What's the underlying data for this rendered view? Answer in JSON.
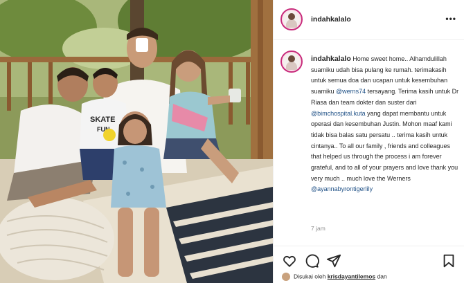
{
  "post": {
    "username": "indahkalalo",
    "more_label": "•••",
    "caption_username": "indahkalalo",
    "caption_parts": [
      {
        "text": " Home sweet home.. Alhamdulillah suamiku udah bisa pulang ke rumah. terimakasih untuk semua doa dan ucapan untuk kesembuhan suamiku ",
        "mention": false
      },
      {
        "text": "@werns74",
        "mention": true
      },
      {
        "text": " tersayang. Terima kasih untuk Dr Riasa dan team dokter dan suster dari ",
        "mention": false
      },
      {
        "text": "@bimchospital.kuta",
        "mention": true
      },
      {
        "text": " yang dapat membantu untuk operasi dan kesembuhan Justin. Mohon maaf kami tidak bisa balas satu persatu .. terima kasih untuk cintanya.. To all our family , friends and colleagues that helped us through the process i am forever grateful, and to all of your prayers and love thank you very much .. much love the Werners ",
        "mention": false
      },
      {
        "text": "@ayannabyrontigerlily",
        "mention": true
      }
    ],
    "time": "7 jam",
    "liked_by_prefix": "Disukai oleh",
    "liked_by_user": "krisdayantilemos",
    "liked_by_suffix": "dan"
  },
  "icons": {
    "like": "heart-icon",
    "comment": "comment-icon",
    "share": "share-icon",
    "save": "bookmark-icon"
  },
  "photo": {
    "shirt_text": "SKATE",
    "shirt_text2": "FUN"
  },
  "colors": {
    "mention": "#1d4f85",
    "avatar_ring": "#c82c7c",
    "muted": "#8e8e8e"
  }
}
